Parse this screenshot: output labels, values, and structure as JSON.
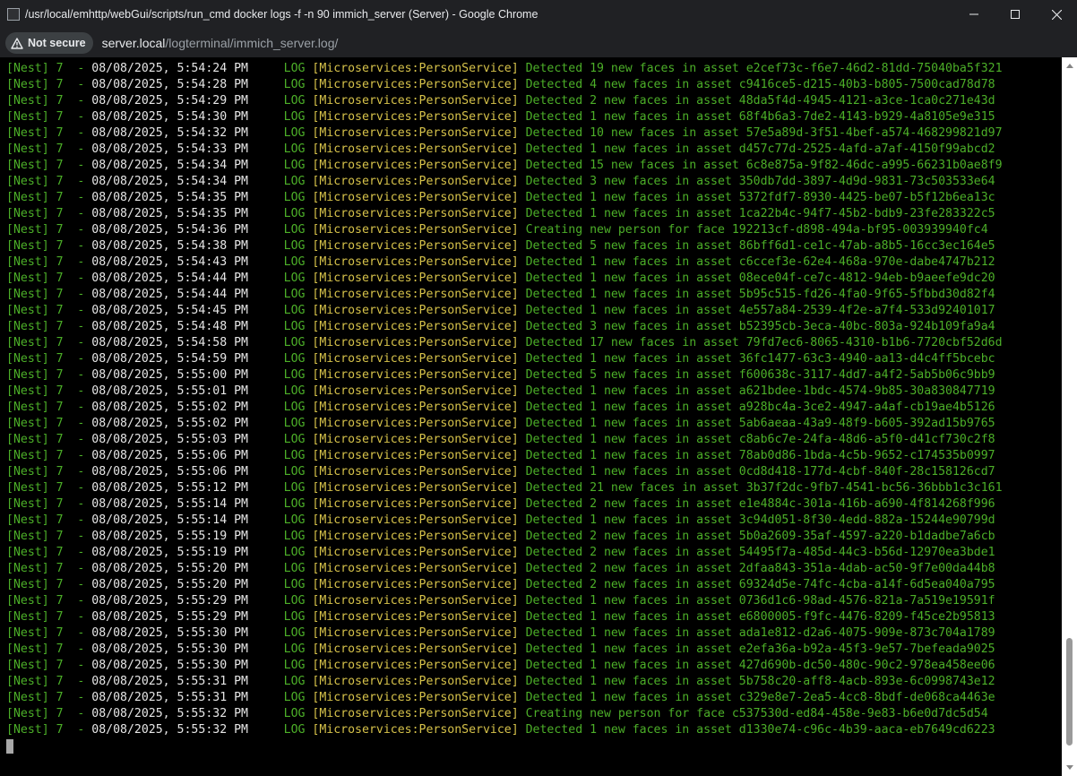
{
  "window": {
    "title": "/usr/local/emhttp/webGui/scripts/run_cmd docker logs -f -n 90 immich_server (Server) - Google Chrome",
    "controls": [
      "minimize-icon",
      "maximize-icon",
      "close-icon"
    ]
  },
  "addressbar": {
    "security_label": "Not secure",
    "security_icon": "warning-triangle-icon",
    "url_host": "server.local",
    "url_path": "/logterminal/immich_server.log/"
  },
  "colors": {
    "title_bg": "#202124",
    "terminal_bg": "#000000",
    "nest_green": "#4caf28",
    "context_yellow": "#d6c24a",
    "datetime_white": "#e6e6e6"
  },
  "log_lines": [
    {
      "nest": "[Nest] 7  - ",
      "datetime": "08/08/2025, 5:54:24 PM",
      "level": "     LOG ",
      "context": "[Microservices:PersonService]",
      "message": " Detected 19 new faces in asset e2cef73c-f6e7-46d2-81dd-75040ba5f321"
    },
    {
      "nest": "[Nest] 7  - ",
      "datetime": "08/08/2025, 5:54:28 PM",
      "level": "     LOG ",
      "context": "[Microservices:PersonService]",
      "message": " Detected 4 new faces in asset c9416ce5-d215-40b3-b805-7500cad78d78"
    },
    {
      "nest": "[Nest] 7  - ",
      "datetime": "08/08/2025, 5:54:29 PM",
      "level": "     LOG ",
      "context": "[Microservices:PersonService]",
      "message": " Detected 2 new faces in asset 48da5f4d-4945-4121-a3ce-1ca0c271e43d"
    },
    {
      "nest": "[Nest] 7  - ",
      "datetime": "08/08/2025, 5:54:30 PM",
      "level": "     LOG ",
      "context": "[Microservices:PersonService]",
      "message": " Detected 1 new faces in asset 68f4b6a3-7de2-4143-b929-4a8105e9e315"
    },
    {
      "nest": "[Nest] 7  - ",
      "datetime": "08/08/2025, 5:54:32 PM",
      "level": "     LOG ",
      "context": "[Microservices:PersonService]",
      "message": " Detected 10 new faces in asset 57e5a89d-3f51-4bef-a574-468299821d97"
    },
    {
      "nest": "[Nest] 7  - ",
      "datetime": "08/08/2025, 5:54:33 PM",
      "level": "     LOG ",
      "context": "[Microservices:PersonService]",
      "message": " Detected 1 new faces in asset d457c77d-2525-4afd-a7af-4150f99abcd2"
    },
    {
      "nest": "[Nest] 7  - ",
      "datetime": "08/08/2025, 5:54:34 PM",
      "level": "     LOG ",
      "context": "[Microservices:PersonService]",
      "message": " Detected 15 new faces in asset 6c8e875a-9f82-46dc-a995-66231b0ae8f9"
    },
    {
      "nest": "[Nest] 7  - ",
      "datetime": "08/08/2025, 5:54:34 PM",
      "level": "     LOG ",
      "context": "[Microservices:PersonService]",
      "message": " Detected 3 new faces in asset 350db7dd-3897-4d9d-9831-73c503533e64"
    },
    {
      "nest": "[Nest] 7  - ",
      "datetime": "08/08/2025, 5:54:35 PM",
      "level": "     LOG ",
      "context": "[Microservices:PersonService]",
      "message": " Detected 1 new faces in asset 5372fdf7-8930-4425-be07-b5f12b6ea13c"
    },
    {
      "nest": "[Nest] 7  - ",
      "datetime": "08/08/2025, 5:54:35 PM",
      "level": "     LOG ",
      "context": "[Microservices:PersonService]",
      "message": " Detected 1 new faces in asset 1ca22b4c-94f7-45b2-bdb9-23fe283322c5"
    },
    {
      "nest": "[Nest] 7  - ",
      "datetime": "08/08/2025, 5:54:36 PM",
      "level": "     LOG ",
      "context": "[Microservices:PersonService]",
      "message": " Creating new person for face 192213cf-d898-494a-bf95-003939940fc4"
    },
    {
      "nest": "[Nest] 7  - ",
      "datetime": "08/08/2025, 5:54:38 PM",
      "level": "     LOG ",
      "context": "[Microservices:PersonService]",
      "message": " Detected 5 new faces in asset 86bff6d1-ce1c-47ab-a8b5-16cc3ec164e5"
    },
    {
      "nest": "[Nest] 7  - ",
      "datetime": "08/08/2025, 5:54:43 PM",
      "level": "     LOG ",
      "context": "[Microservices:PersonService]",
      "message": " Detected 1 new faces in asset c6ccef3e-62e4-468a-970e-dabe4747b212"
    },
    {
      "nest": "[Nest] 7  - ",
      "datetime": "08/08/2025, 5:54:44 PM",
      "level": "     LOG ",
      "context": "[Microservices:PersonService]",
      "message": " Detected 1 new faces in asset 08ece04f-ce7c-4812-94eb-b9aeefe9dc20"
    },
    {
      "nest": "[Nest] 7  - ",
      "datetime": "08/08/2025, 5:54:44 PM",
      "level": "     LOG ",
      "context": "[Microservices:PersonService]",
      "message": " Detected 1 new faces in asset 5b95c515-fd26-4fa0-9f65-5fbbd30d82f4"
    },
    {
      "nest": "[Nest] 7  - ",
      "datetime": "08/08/2025, 5:54:45 PM",
      "level": "     LOG ",
      "context": "[Microservices:PersonService]",
      "message": " Detected 1 new faces in asset 4e557a84-2539-4f2e-a7f4-533d92401017"
    },
    {
      "nest": "[Nest] 7  - ",
      "datetime": "08/08/2025, 5:54:48 PM",
      "level": "     LOG ",
      "context": "[Microservices:PersonService]",
      "message": " Detected 3 new faces in asset b52395cb-3eca-40bc-803a-924b109fa9a4"
    },
    {
      "nest": "[Nest] 7  - ",
      "datetime": "08/08/2025, 5:54:58 PM",
      "level": "     LOG ",
      "context": "[Microservices:PersonService]",
      "message": " Detected 17 new faces in asset 79fd7ec6-8065-4310-b1b6-7720cbf52d6d"
    },
    {
      "nest": "[Nest] 7  - ",
      "datetime": "08/08/2025, 5:54:59 PM",
      "level": "     LOG ",
      "context": "[Microservices:PersonService]",
      "message": " Detected 1 new faces in asset 36fc1477-63c3-4940-aa13-d4c4ff5bcebc"
    },
    {
      "nest": "[Nest] 7  - ",
      "datetime": "08/08/2025, 5:55:00 PM",
      "level": "     LOG ",
      "context": "[Microservices:PersonService]",
      "message": " Detected 5 new faces in asset f600638c-3117-4dd7-a4f2-5ab5b06c9bb9"
    },
    {
      "nest": "[Nest] 7  - ",
      "datetime": "08/08/2025, 5:55:01 PM",
      "level": "     LOG ",
      "context": "[Microservices:PersonService]",
      "message": " Detected 1 new faces in asset a621bdee-1bdc-4574-9b85-30a830847719"
    },
    {
      "nest": "[Nest] 7  - ",
      "datetime": "08/08/2025, 5:55:02 PM",
      "level": "     LOG ",
      "context": "[Microservices:PersonService]",
      "message": " Detected 1 new faces in asset a928bc4a-3ce2-4947-a4af-cb19ae4b5126"
    },
    {
      "nest": "[Nest] 7  - ",
      "datetime": "08/08/2025, 5:55:02 PM",
      "level": "     LOG ",
      "context": "[Microservices:PersonService]",
      "message": " Detected 1 new faces in asset 5ab6aeaa-43a9-48f9-b605-392ad15b9765"
    },
    {
      "nest": "[Nest] 7  - ",
      "datetime": "08/08/2025, 5:55:03 PM",
      "level": "     LOG ",
      "context": "[Microservices:PersonService]",
      "message": " Detected 1 new faces in asset c8ab6c7e-24fa-48d6-a5f0-d41cf730c2f8"
    },
    {
      "nest": "[Nest] 7  - ",
      "datetime": "08/08/2025, 5:55:06 PM",
      "level": "     LOG ",
      "context": "[Microservices:PersonService]",
      "message": " Detected 1 new faces in asset 78ab0d86-1bda-4c5b-9652-c174535b0997"
    },
    {
      "nest": "[Nest] 7  - ",
      "datetime": "08/08/2025, 5:55:06 PM",
      "level": "     LOG ",
      "context": "[Microservices:PersonService]",
      "message": " Detected 1 new faces in asset 0cd8d418-177d-4cbf-840f-28c158126cd7"
    },
    {
      "nest": "[Nest] 7  - ",
      "datetime": "08/08/2025, 5:55:12 PM",
      "level": "     LOG ",
      "context": "[Microservices:PersonService]",
      "message": " Detected 21 new faces in asset 3b37f2dc-9fb7-4541-bc56-36bbb1c3c161"
    },
    {
      "nest": "[Nest] 7  - ",
      "datetime": "08/08/2025, 5:55:14 PM",
      "level": "     LOG ",
      "context": "[Microservices:PersonService]",
      "message": " Detected 2 new faces in asset e1e4884c-301a-416b-a690-4f814268f996"
    },
    {
      "nest": "[Nest] 7  - ",
      "datetime": "08/08/2025, 5:55:14 PM",
      "level": "     LOG ",
      "context": "[Microservices:PersonService]",
      "message": " Detected 1 new faces in asset 3c94d051-8f30-4edd-882a-15244e90799d"
    },
    {
      "nest": "[Nest] 7  - ",
      "datetime": "08/08/2025, 5:55:19 PM",
      "level": "     LOG ",
      "context": "[Microservices:PersonService]",
      "message": " Detected 2 new faces in asset 5b0a2609-35af-4597-a220-b1dadbe7a6cb"
    },
    {
      "nest": "[Nest] 7  - ",
      "datetime": "08/08/2025, 5:55:19 PM",
      "level": "     LOG ",
      "context": "[Microservices:PersonService]",
      "message": " Detected 2 new faces in asset 54495f7a-485d-44c3-b56d-12970ea3bde1"
    },
    {
      "nest": "[Nest] 7  - ",
      "datetime": "08/08/2025, 5:55:20 PM",
      "level": "     LOG ",
      "context": "[Microservices:PersonService]",
      "message": " Detected 2 new faces in asset 2dfaa843-351a-4dab-ac50-9f7e00da44b8"
    },
    {
      "nest": "[Nest] 7  - ",
      "datetime": "08/08/2025, 5:55:20 PM",
      "level": "     LOG ",
      "context": "[Microservices:PersonService]",
      "message": " Detected 2 new faces in asset 69324d5e-74fc-4cba-a14f-6d5ea040a795"
    },
    {
      "nest": "[Nest] 7  - ",
      "datetime": "08/08/2025, 5:55:29 PM",
      "level": "     LOG ",
      "context": "[Microservices:PersonService]",
      "message": " Detected 1 new faces in asset 0736d1c6-98ad-4576-821a-7a519e19591f"
    },
    {
      "nest": "[Nest] 7  - ",
      "datetime": "08/08/2025, 5:55:29 PM",
      "level": "     LOG ",
      "context": "[Microservices:PersonService]",
      "message": " Detected 1 new faces in asset e6800005-f9fc-4476-8209-f45ce2b95813"
    },
    {
      "nest": "[Nest] 7  - ",
      "datetime": "08/08/2025, 5:55:30 PM",
      "level": "     LOG ",
      "context": "[Microservices:PersonService]",
      "message": " Detected 1 new faces in asset ada1e812-d2a6-4075-909e-873c704a1789"
    },
    {
      "nest": "[Nest] 7  - ",
      "datetime": "08/08/2025, 5:55:30 PM",
      "level": "     LOG ",
      "context": "[Microservices:PersonService]",
      "message": " Detected 1 new faces in asset e2efa36a-b92a-45f3-9e57-7befeada9025"
    },
    {
      "nest": "[Nest] 7  - ",
      "datetime": "08/08/2025, 5:55:30 PM",
      "level": "     LOG ",
      "context": "[Microservices:PersonService]",
      "message": " Detected 1 new faces in asset 427d690b-dc50-480c-90c2-978ea458ee06"
    },
    {
      "nest": "[Nest] 7  - ",
      "datetime": "08/08/2025, 5:55:31 PM",
      "level": "     LOG ",
      "context": "[Microservices:PersonService]",
      "message": " Detected 1 new faces in asset 5b758c20-aff8-4acb-893e-6c0998743e12"
    },
    {
      "nest": "[Nest] 7  - ",
      "datetime": "08/08/2025, 5:55:31 PM",
      "level": "     LOG ",
      "context": "[Microservices:PersonService]",
      "message": " Detected 1 new faces in asset c329e8e7-2ea5-4cc8-8bdf-de068ca4463e"
    },
    {
      "nest": "[Nest] 7  - ",
      "datetime": "08/08/2025, 5:55:32 PM",
      "level": "     LOG ",
      "context": "[Microservices:PersonService]",
      "message": " Creating new person for face c537530d-ed84-458e-9e83-b6e0d7dc5d54"
    },
    {
      "nest": "[Nest] 7  - ",
      "datetime": "08/08/2025, 5:55:32 PM",
      "level": "     LOG ",
      "context": "[Microservices:PersonService]",
      "message": " Detected 1 new faces in asset d1330e74-c96c-4b39-aaca-eb7649cd6223"
    }
  ]
}
